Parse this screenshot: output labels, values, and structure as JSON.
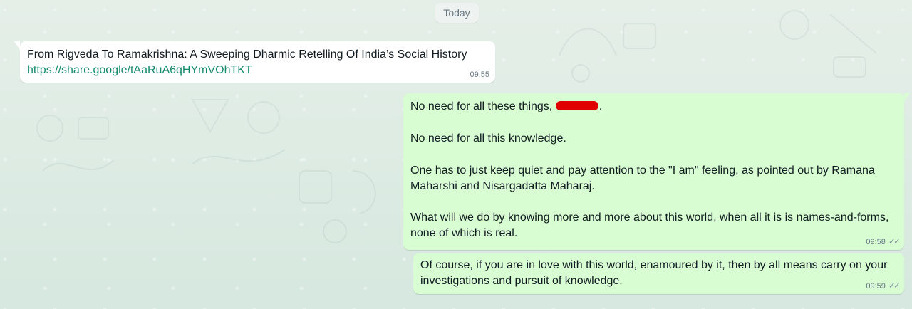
{
  "chat": {
    "date_separator": "Today"
  },
  "messages": {
    "incoming": {
      "line1": "From Rigveda To Ramakrishna: A Sweeping Dharmic Retelling Of India’s Social History",
      "link": "https://share.google/tAaRuA6qHYmVOhTKT",
      "time": "09:55"
    },
    "outgoing1": {
      "line1_before_redaction": "No need for all these things, ",
      "line1_after_redaction": ".",
      "line2": "No need for all this knowledge.",
      "line3": "One has to just keep quiet and pay attention to the \"I am\" feeling, as pointed out by Ramana Maharshi and Nisargadatta Maharaj.",
      "line4": "What will we do by knowing more and more about this world, when all it is is names-and-forms, none of which is real.",
      "time": "09:58",
      "status_icon": "double-check-icon"
    },
    "outgoing2": {
      "text": "Of course, if you are in love with this world, enamoured by it, then by all means carry on your investigations and pursuit of knowledge.",
      "time": "09:59",
      "status_icon": "double-check-icon"
    }
  },
  "colors": {
    "background": "#d7e9e1",
    "incoming_bubble": "#ffffff",
    "outgoing_bubble": "#d9fdd3",
    "link": "#168a6d",
    "meta_text": "#667781",
    "redaction": "#e00000"
  }
}
